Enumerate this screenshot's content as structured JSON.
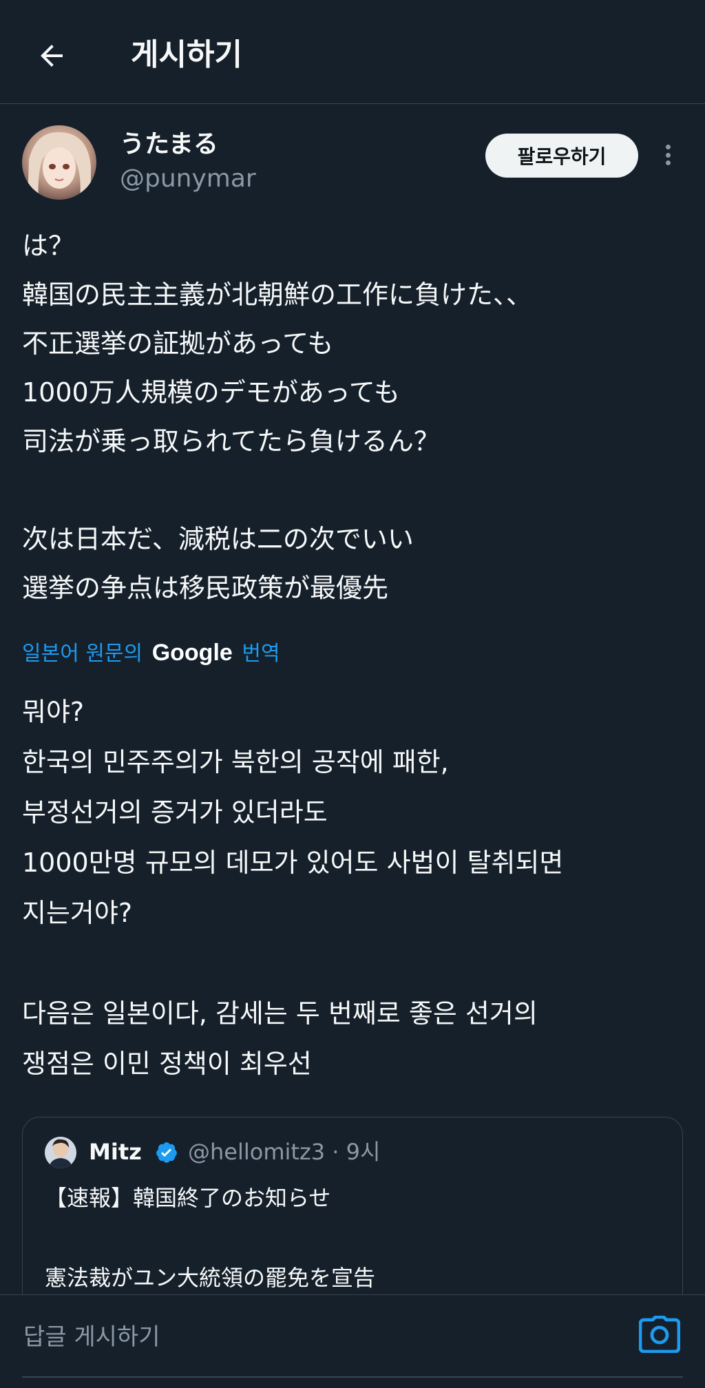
{
  "header": {
    "title": "게시하기",
    "back_icon": "arrow-left-icon"
  },
  "author": {
    "display_name": "うたまる",
    "handle": "@punymar",
    "follow_label": "팔로우하기",
    "more_icon": "more-vertical-icon"
  },
  "tweet": {
    "lines": [
      "は？",
      "韓国の民主主義が北朝鮮の工作に負けた、、",
      "不正選挙の証拠があっても",
      "1000万人規模のデモがあっても",
      "司法が乗っ取られてたら負けるん？",
      "",
      "次は日本だ、減税は二の次でいい",
      "選挙の争点は移民政策が最優先"
    ]
  },
  "translation": {
    "prefix": "일본어 원문의",
    "brand": "Google",
    "suffix": "번역",
    "lines": [
      "뭐야?",
      "한국의 민주주의가 북한의 공작에 패한,",
      "부정선거의 증거가 있더라도",
      "1000만명 규모의 데모가 있어도 사법이 탈취되면",
      "지는거야?",
      "",
      "다음은 일본이다, 감세는 두 번째로 좋은 선거의",
      "쟁점은 이민 정책이 최우선"
    ]
  },
  "quote": {
    "name": "Mitz",
    "handle": "@hellomitz3",
    "separator": "·",
    "time": "9시",
    "verified_icon": "verified-badge-icon",
    "lines": [
      "【速報】韓国終了のお知らせ",
      "",
      "憲法裁がユン大統領の罷免を宣告"
    ]
  },
  "reply": {
    "placeholder": "답글 게시하기",
    "camera_icon": "camera-icon"
  },
  "colors": {
    "background": "#15202b",
    "text": "#f7f9f9",
    "secondary": "#8b98a5",
    "accent": "#1d9bf0",
    "border": "#38444d"
  }
}
